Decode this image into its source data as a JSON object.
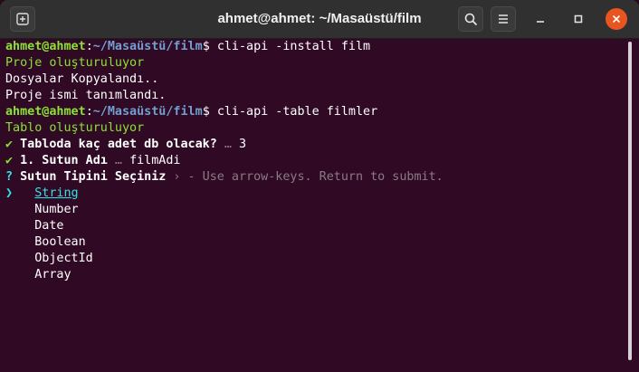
{
  "window": {
    "title": "ahmet@ahmet: ~/Masaüstü/film"
  },
  "icons": {
    "new_tab": "new-tab-icon",
    "search": "search-icon",
    "menu": "hamburger-menu-icon",
    "minimize": "minimize-icon",
    "maximize": "maximize-icon",
    "close": "close-icon"
  },
  "colors": {
    "background": "#300a24",
    "prompt_user": "#8ae234",
    "prompt_path": "#729fcf",
    "accent": "#34e2e2",
    "close_button": "#e95420"
  },
  "terminal": {
    "prompt1": {
      "user": "ahmet@ahmet",
      "sep": ":",
      "path": "~/Masaüstü/film",
      "dollar": "$ ",
      "command": "cli-api -install film"
    },
    "out1": "Proje oluşturuluyor",
    "out2": "Dosyalar Kopyalandı..",
    "out3": "Proje ismi tanımlandı.",
    "prompt2": {
      "user": "ahmet@ahmet",
      "sep": ":",
      "path": "~/Masaüstü/film",
      "dollar": "$ ",
      "command": "cli-api -table filmler"
    },
    "out4": "Tablo oluşturuluyor",
    "q1": {
      "mark": "✔",
      "question": "Tabloda kaç adet db olacak?",
      "ellipsis": " … ",
      "answer": "3"
    },
    "q2": {
      "mark": "✔",
      "question": "1. Sutun Adı",
      "ellipsis": " … ",
      "answer": "filmAdi"
    },
    "q3": {
      "mark": "?",
      "question": "Sutun Tipini Seçiniz",
      "hint": " › - Use arrow-keys. Return to submit."
    },
    "pointer": "❯",
    "options": [
      "String",
      "Number",
      "Date",
      "Boolean",
      "ObjectId",
      "Array"
    ]
  }
}
